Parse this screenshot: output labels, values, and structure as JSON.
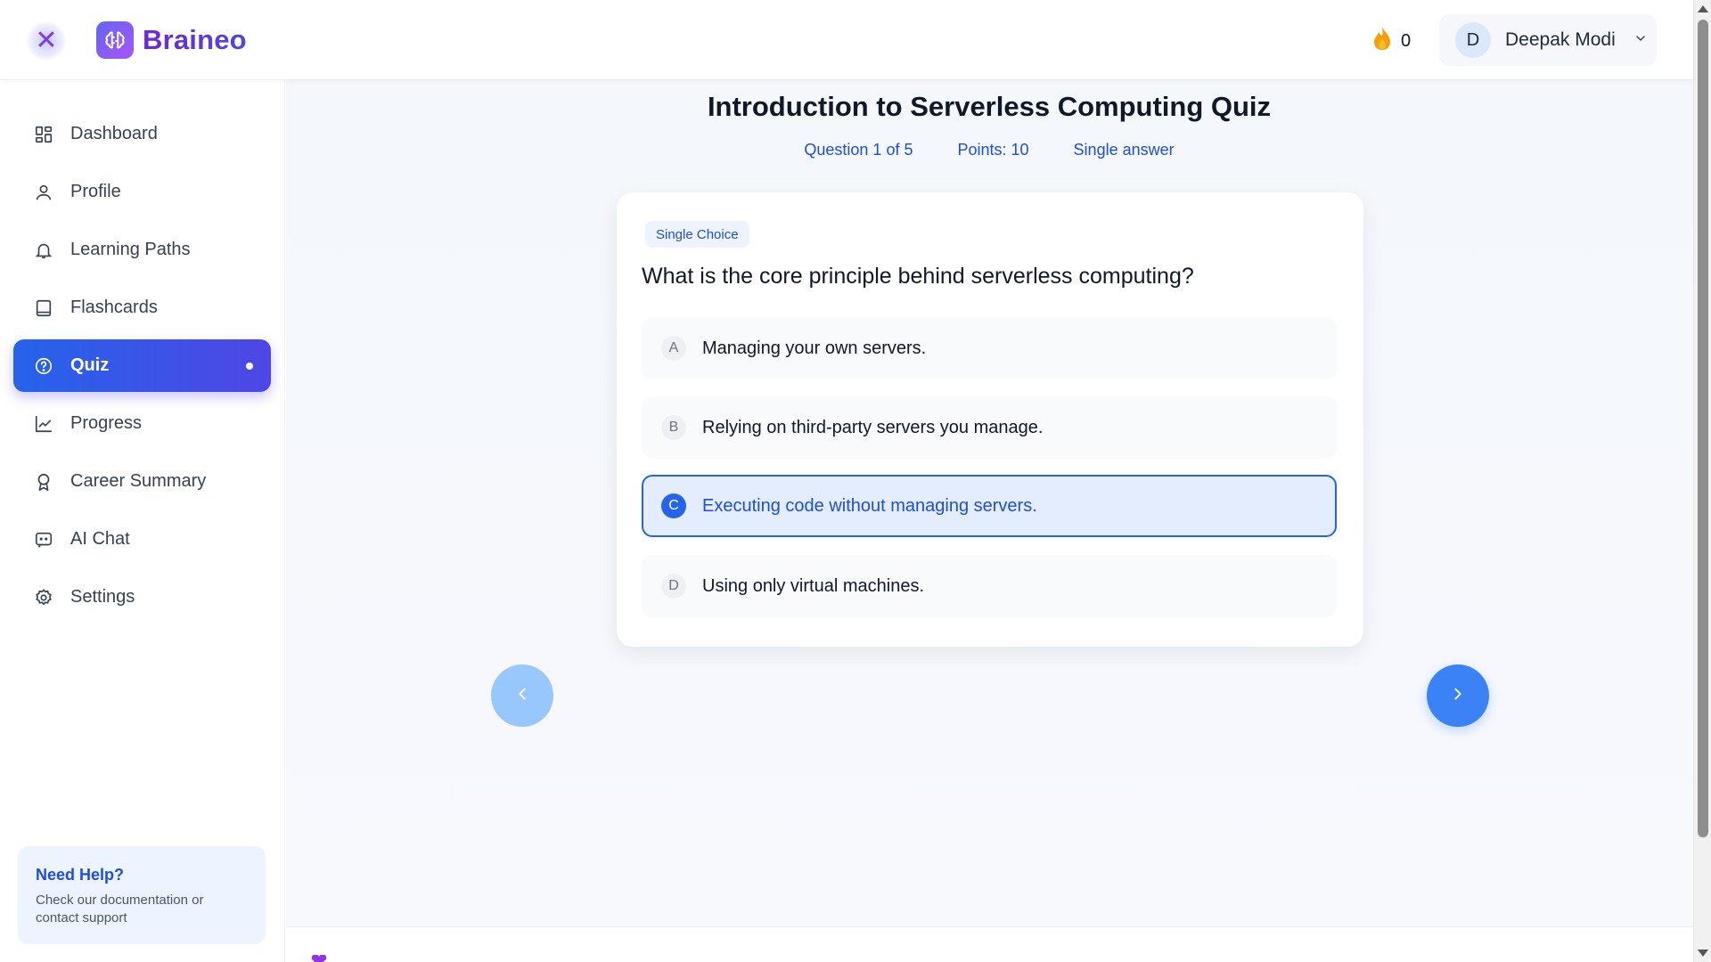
{
  "app": {
    "name": "Braineo",
    "close_icon": "close-icon",
    "brand_colors": {
      "primary": "#2563eb",
      "accent": "#6d28d9"
    }
  },
  "header": {
    "streak_count": "0",
    "streak_icon": "fire-icon",
    "user": {
      "avatar_letter": "D",
      "name": "Deepak Modi"
    }
  },
  "sidebar": {
    "items": [
      {
        "label": "Dashboard",
        "icon": "dashboard-icon"
      },
      {
        "label": "Profile",
        "icon": "user-icon"
      },
      {
        "label": "Learning Paths",
        "icon": "bell-icon"
      },
      {
        "label": "Flashcards",
        "icon": "book-icon"
      },
      {
        "label": "Quiz",
        "icon": "help-circle-icon",
        "active": true
      },
      {
        "label": "Progress",
        "icon": "chart-line-icon"
      },
      {
        "label": "Career Summary",
        "icon": "award-icon"
      },
      {
        "label": "AI Chat",
        "icon": "chat-icon"
      },
      {
        "label": "Settings",
        "icon": "gear-icon"
      }
    ],
    "help": {
      "title": "Need Help?",
      "text": "Check our documentation or contact support"
    }
  },
  "quiz": {
    "title": "Introduction to Serverless Computing Quiz",
    "meta": {
      "question_progress": "Question 1 of 5",
      "points": "Points: 10",
      "answer_type": "Single answer"
    },
    "question": {
      "badge": "Single Choice",
      "text": "What is the core principle behind serverless computing?",
      "options": [
        {
          "letter": "A",
          "text": "Managing your own servers."
        },
        {
          "letter": "B",
          "text": "Relying on third-party servers you manage."
        },
        {
          "letter": "C",
          "text": "Executing code without managing servers.",
          "selected": true
        },
        {
          "letter": "D",
          "text": "Using only virtual machines."
        }
      ]
    },
    "navigation": {
      "prev_icon": "chevron-left-icon",
      "next_icon": "chevron-right-icon"
    }
  }
}
